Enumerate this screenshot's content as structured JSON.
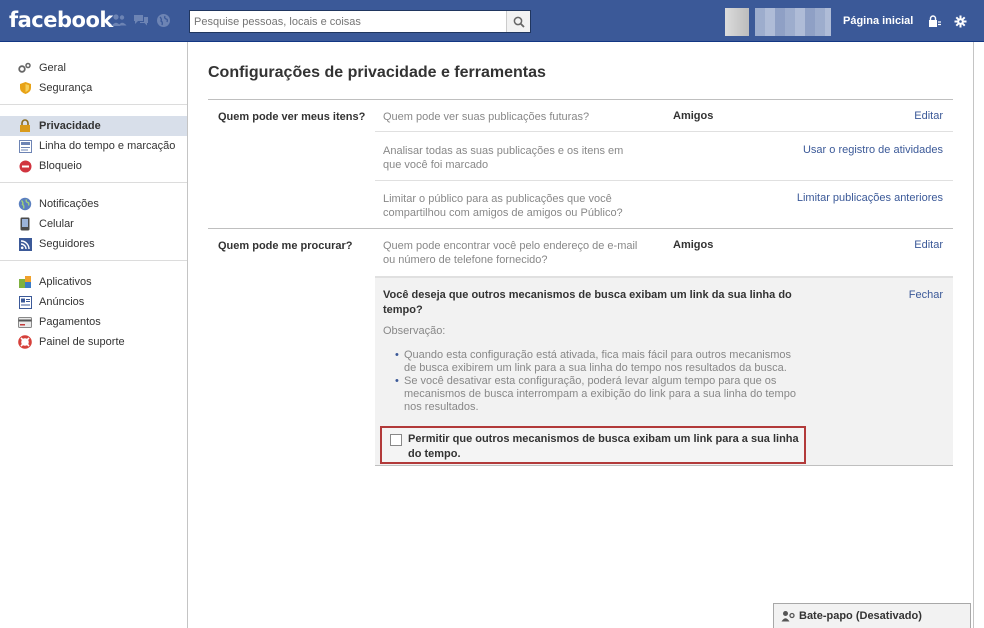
{
  "topbar": {
    "logo": "facebook",
    "search_placeholder": "Pesquise pessoas, locais e coisas",
    "home_label": "Página inicial",
    "brand_color": "#3b5998"
  },
  "sidebar": {
    "groups": [
      [
        {
          "label": "Geral",
          "icon": "gear-icon"
        },
        {
          "label": "Segurança",
          "icon": "shield-icon"
        }
      ],
      [
        {
          "label": "Privacidade",
          "icon": "lock-icon",
          "active": true
        },
        {
          "label": "Linha do tempo e marcação",
          "icon": "timeline-icon"
        },
        {
          "label": "Bloqueio",
          "icon": "block-icon"
        }
      ],
      [
        {
          "label": "Notificações",
          "icon": "globe-icon"
        },
        {
          "label": "Celular",
          "icon": "phone-icon"
        },
        {
          "label": "Seguidores",
          "icon": "rss-icon"
        }
      ],
      [
        {
          "label": "Aplicativos",
          "icon": "apps-icon"
        },
        {
          "label": "Anúncios",
          "icon": "ads-icon"
        },
        {
          "label": "Pagamentos",
          "icon": "card-icon"
        },
        {
          "label": "Painel de suporte",
          "icon": "lifebuoy-icon"
        }
      ]
    ]
  },
  "main": {
    "title": "Configurações de privacidade e ferramentas",
    "sections": [
      {
        "label": "Quem pode ver meus itens?",
        "rows": [
          {
            "text": "Quem pode ver suas publicações futuras?",
            "value": "Amigos",
            "action": "Editar"
          },
          {
            "text": "Analisar todas as suas publicações e os itens em que você foi marcado",
            "value": "",
            "action": "Usar o registro de atividades"
          },
          {
            "text": "Limitar o público para as publicações que você compartilhou com amigos de amigos ou Público?",
            "value": "",
            "action": "Limitar publicações anteriores"
          }
        ]
      },
      {
        "label": "Quem pode me procurar?",
        "rows": [
          {
            "text": "Quem pode encontrar você pelo endereço de e-mail ou número de telefone fornecido?",
            "value": "Amigos",
            "action": "Editar"
          }
        ]
      }
    ],
    "panel": {
      "question": "Você deseja que outros mecanismos de busca exibam um link da sua linha do tempo?",
      "close": "Fechar",
      "observation": "Observação:",
      "bullets": [
        "Quando esta configuração está ativada, fica mais fácil para outros mecanismos de busca exibirem um link para a sua linha do tempo nos resultados da busca.",
        "Se você desativar esta configuração, poderá levar algum tempo para que os mecanismos de busca interrompam a exibição do link para a sua linha do tempo nos resultados."
      ],
      "checkbox_label": "Permitir que outros mecanismos de busca exibam um link para a sua linha do tempo.",
      "checkbox_checked": false,
      "highlight_color": "#b23a3a"
    }
  },
  "chat": {
    "label": "Bate-papo (Desativado)"
  }
}
